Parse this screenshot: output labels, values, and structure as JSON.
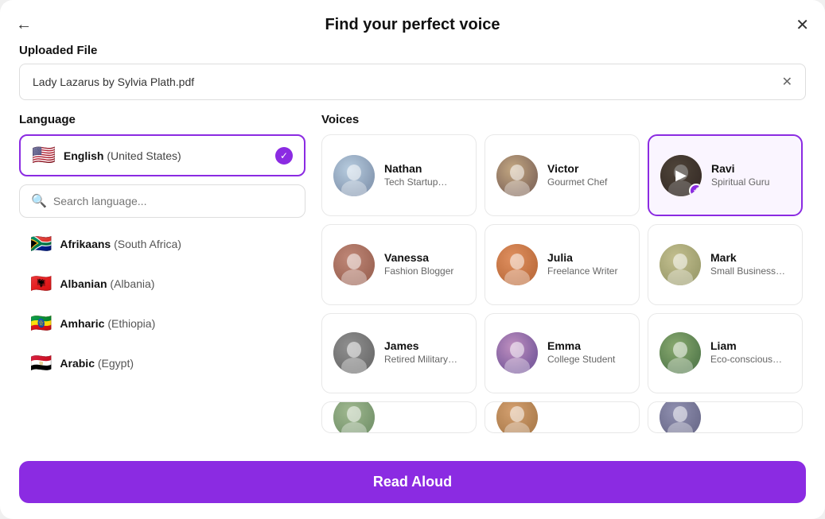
{
  "modal": {
    "title": "Find your perfect voice",
    "back_label": "←",
    "close_label": "✕"
  },
  "file_section": {
    "label": "Uploaded File",
    "filename": "Lady Lazarus by Sylvia Plath.pdf",
    "clear_label": "✕"
  },
  "language_section": {
    "label": "Language",
    "selected": {
      "flag": "🇺🇸",
      "name": "English",
      "region": "(United States)"
    },
    "search_placeholder": "Search language...",
    "languages": [
      {
        "flag": "🇿🇦",
        "name": "Afrikaans",
        "region": "(South Africa)"
      },
      {
        "flag": "🇦🇱",
        "name": "Albanian",
        "region": "(Albania)"
      },
      {
        "flag": "🇪🇹",
        "name": "Amharic",
        "region": "(Ethiopia)"
      },
      {
        "flag": "🇪🇬",
        "name": "Arabic",
        "region": "(Egypt)"
      }
    ]
  },
  "voices_section": {
    "label": "Voices",
    "voices": [
      {
        "id": "nathan",
        "name": "Nathan",
        "role": "Tech Startup…",
        "avatar_class": "av-nathan",
        "selected": false
      },
      {
        "id": "victor",
        "name": "Victor",
        "role": "Gourmet Chef",
        "avatar_class": "av-victor",
        "selected": false
      },
      {
        "id": "ravi",
        "name": "Ravi",
        "role": "Spiritual Guru",
        "avatar_class": "av-ravi",
        "selected": true
      },
      {
        "id": "vanessa",
        "name": "Vanessa",
        "role": "Fashion Blogger",
        "avatar_class": "av-vanessa",
        "selected": false
      },
      {
        "id": "julia",
        "name": "Julia",
        "role": "Freelance Writer",
        "avatar_class": "av-julia",
        "selected": false
      },
      {
        "id": "mark",
        "name": "Mark",
        "role": "Small Business…",
        "avatar_class": "av-mark",
        "selected": false
      },
      {
        "id": "james",
        "name": "James",
        "role": "Retired Military…",
        "avatar_class": "av-james",
        "selected": false
      },
      {
        "id": "emma",
        "name": "Emma",
        "role": "College Student",
        "avatar_class": "av-emma",
        "selected": false
      },
      {
        "id": "liam",
        "name": "Liam",
        "role": "Eco-conscious…",
        "avatar_class": "av-liam",
        "selected": false
      },
      {
        "id": "partial1",
        "name": "",
        "role": "",
        "avatar_class": "av-partial1",
        "selected": false,
        "partial": true
      },
      {
        "id": "partial2",
        "name": "",
        "role": "",
        "avatar_class": "av-partial2",
        "selected": false,
        "partial": true
      },
      {
        "id": "partial3",
        "name": "",
        "role": "",
        "avatar_class": "av-partial3",
        "selected": false,
        "partial": true
      }
    ]
  },
  "bottom": {
    "read_aloud_label": "Read Aloud"
  }
}
